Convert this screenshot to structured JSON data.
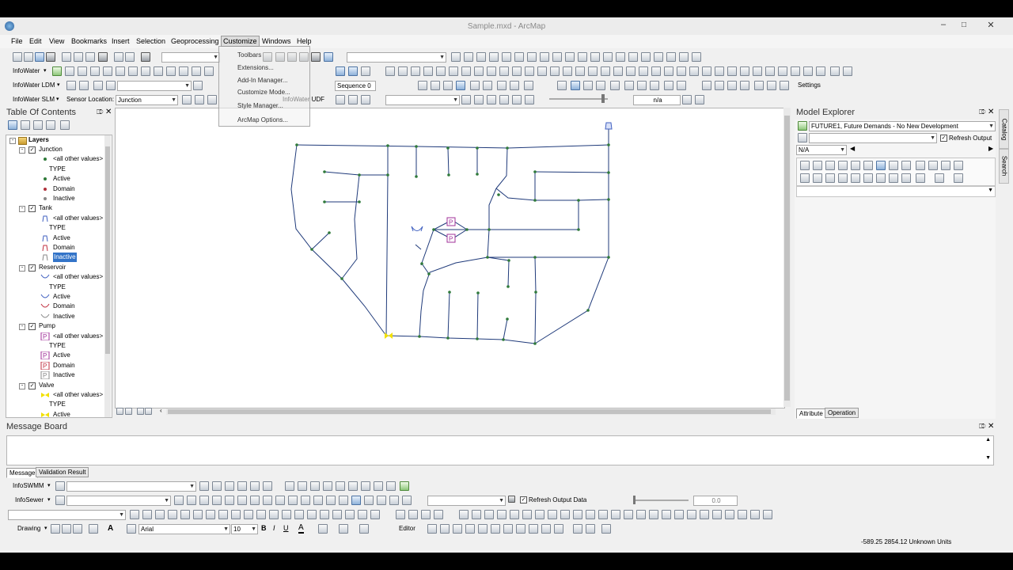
{
  "window": {
    "title": "Sample.mxd - ArcMap"
  },
  "menu": [
    "File",
    "Edit",
    "View",
    "Bookmarks",
    "Insert",
    "Selection",
    "Geoprocessing",
    "Customize",
    "Windows",
    "Help"
  ],
  "customize_menu": [
    "Toolbars",
    "Extensions...",
    "Add-In Manager...",
    "Customize Mode...",
    "Style Manager...",
    "ArcMap Options..."
  ],
  "toolbars": {
    "infowater_label": "InfoWater",
    "infowater_ldm_label": "InfoWater LDM",
    "infowater_slm_label": "InfoWater SLM",
    "sensor_location_label": "Sensor Location:",
    "sensor_location_value": "Junction",
    "infowater_udf_label": "InfoWater UDF",
    "sequence_label": "Sequence 0",
    "settings_label": "Settings",
    "na_value": "n/a"
  },
  "toc": {
    "title": "Table Of Contents",
    "root": "Layers",
    "rows": [
      {
        "text": "Junction",
        "kind": "layer"
      },
      {
        "text": "<all other values>",
        "kind": "sym",
        "sym": "dot-green"
      },
      {
        "text": "TYPE",
        "kind": "field"
      },
      {
        "text": "Active",
        "kind": "sym",
        "sym": "dot-green"
      },
      {
        "text": "Domain",
        "kind": "sym",
        "sym": "dot-red"
      },
      {
        "text": "Inactive",
        "kind": "sym",
        "sym": "dot-gray"
      },
      {
        "text": "Tank",
        "kind": "layer"
      },
      {
        "text": "<all other values>",
        "kind": "sym",
        "sym": "tank-blue"
      },
      {
        "text": "TYPE",
        "kind": "field"
      },
      {
        "text": "Active",
        "kind": "sym",
        "sym": "tank-blue"
      },
      {
        "text": "Domain",
        "kind": "sym",
        "sym": "tank-red"
      },
      {
        "text": "Inactive",
        "kind": "sym",
        "sym": "tank-gray",
        "selected": true
      },
      {
        "text": "Reservoir",
        "kind": "layer"
      },
      {
        "text": "<all other values>",
        "kind": "sym",
        "sym": "res-blue"
      },
      {
        "text": "TYPE",
        "kind": "field"
      },
      {
        "text": "Active",
        "kind": "sym",
        "sym": "res-blue"
      },
      {
        "text": "Domain",
        "kind": "sym",
        "sym": "res-red"
      },
      {
        "text": "Inactive",
        "kind": "sym",
        "sym": "res-gray"
      },
      {
        "text": "Pump",
        "kind": "layer"
      },
      {
        "text": "<all other values>",
        "kind": "sym",
        "sym": "pump-purple"
      },
      {
        "text": "TYPE",
        "kind": "field"
      },
      {
        "text": "Active",
        "kind": "sym",
        "sym": "pump-purple"
      },
      {
        "text": "Domain",
        "kind": "sym",
        "sym": "pump-red"
      },
      {
        "text": "Inactive",
        "kind": "sym",
        "sym": "pump-gray"
      },
      {
        "text": "Valve",
        "kind": "layer"
      },
      {
        "text": "<all other values>",
        "kind": "sym",
        "sym": "valve-yellow"
      },
      {
        "text": "TYPE",
        "kind": "field"
      },
      {
        "text": "Active",
        "kind": "sym",
        "sym": "valve-yellow"
      }
    ]
  },
  "model_explorer": {
    "title": "Model Explorer",
    "scenario": "FUTURE1, Future Demands - No New Development",
    "refresh_output_label": "Refresh Output",
    "na_value": "N/A",
    "tabs": [
      "Attribute",
      "Operation"
    ]
  },
  "side_tabs": [
    "Catalog",
    "Search"
  ],
  "message_board": {
    "title": "Message Board",
    "tabs": [
      "Message",
      "Validation Result"
    ]
  },
  "bottom_toolbars": {
    "infoswmm_label": "InfoSWMM",
    "infosewer_label": "InfoSewer",
    "refresh_output_data_label": "Refresh Output Data",
    "output_value": "0.0",
    "drawing_label": "Drawing",
    "font_name": "Arial",
    "font_size": "10",
    "editor_label": "Editor"
  },
  "status": {
    "coords": "-589.25  2854.12 Unknown Units"
  },
  "colors": {
    "network_line": "#1f3a7a",
    "node": "#2f7a3a",
    "pump": "#a0309a",
    "valve": "#f2e000",
    "tank": "#4060c0"
  }
}
